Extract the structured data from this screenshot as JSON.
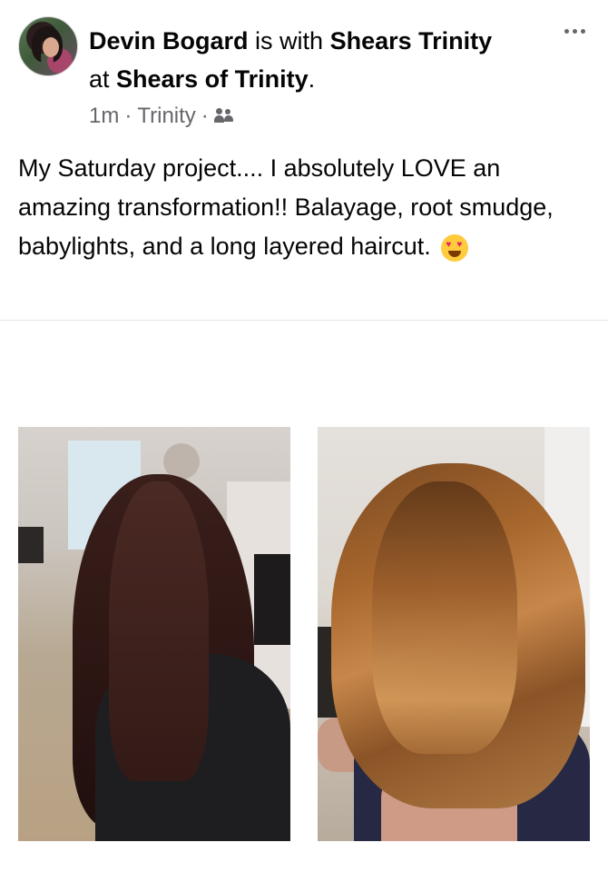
{
  "post": {
    "author": "Devin Bogard",
    "with_text": " is with ",
    "tagged": "Shears Trinity",
    "at_text": "at ",
    "location": "Shears of Trinity",
    "period": ".",
    "time": "1m",
    "sep1": "·",
    "place": "Trinity",
    "sep2": "·",
    "audience_icon": "group-icon",
    "more_icon": "more-options-icon",
    "text": "My Saturday project.... I absolutely LOVE an amazing transformation!! Balayage, root smudge, babylights, and a long layered haircut.",
    "emoji": "heart-eyes-emoji"
  },
  "photos": [
    {
      "name": "before-photo"
    },
    {
      "name": "after-photo"
    }
  ],
  "colors": {
    "text": "#050505",
    "secondary": "#65676b",
    "divider": "#e4e6eb"
  }
}
